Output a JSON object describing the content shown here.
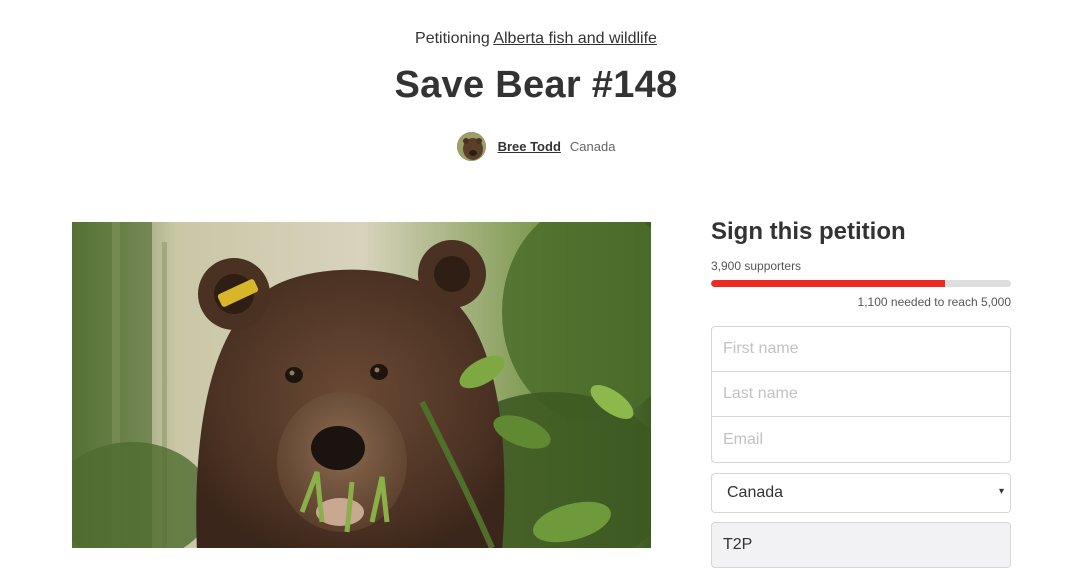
{
  "header": {
    "petitioning_prefix": "Petitioning",
    "target": "Alberta fish and wildlife",
    "title": "Save Bear #148"
  },
  "author": {
    "name": "Bree Todd",
    "location": "Canada"
  },
  "sign": {
    "title": "Sign this petition",
    "supporters_text": "3,900 supporters",
    "supporters": 3900,
    "goal": 5000,
    "progress_fraction": 0.78,
    "needed_text": "1,100 needed to reach 5,000",
    "progress_color": "#ec2c22",
    "fields": {
      "first_name_placeholder": "First name",
      "last_name_placeholder": "Last name",
      "email_placeholder": "Email"
    },
    "country": "Canada",
    "postal_code": "T2P"
  },
  "icons": {
    "select_caret": "▾"
  }
}
